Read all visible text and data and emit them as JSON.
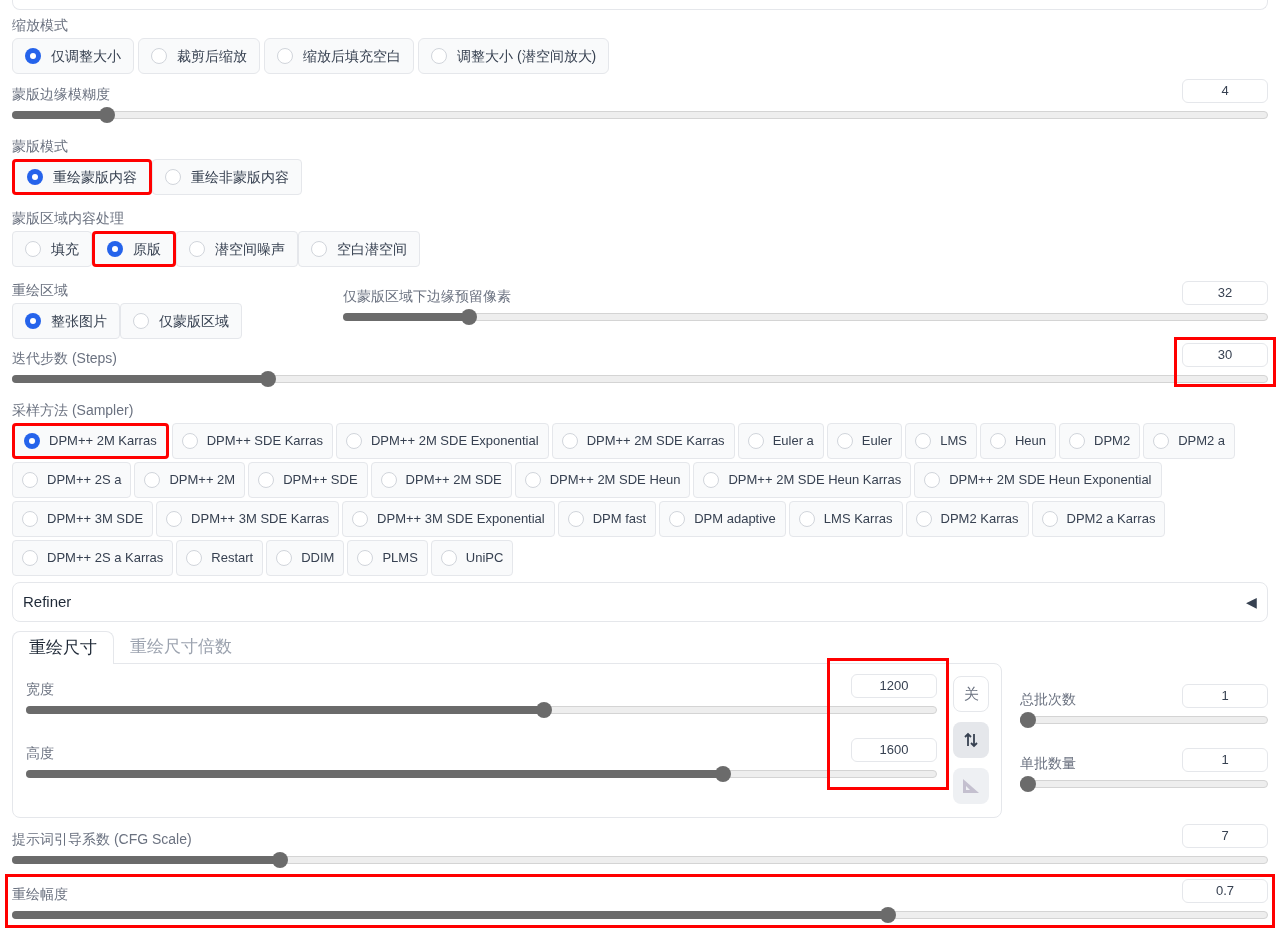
{
  "resize_mode": {
    "label": "缩放模式",
    "options": [
      {
        "label": "仅调整大小",
        "selected": true,
        "highlighted": false
      },
      {
        "label": "裁剪后缩放",
        "selected": false,
        "highlighted": false
      },
      {
        "label": "缩放后填充空白",
        "selected": false,
        "highlighted": false
      },
      {
        "label": "调整大小 (潜空间放大)",
        "selected": false,
        "highlighted": false
      }
    ]
  },
  "mask_blur": {
    "label": "蒙版边缘模糊度",
    "value": "4",
    "level": 0.07
  },
  "mask_mode": {
    "label": "蒙版模式",
    "options": [
      {
        "label": "重绘蒙版内容",
        "selected": true,
        "highlighted": true
      },
      {
        "label": "重绘非蒙版内容",
        "selected": false,
        "highlighted": false
      }
    ]
  },
  "masked_content": {
    "label": "蒙版区域内容处理",
    "options": [
      {
        "label": "填充",
        "selected": false,
        "highlighted": false
      },
      {
        "label": "原版",
        "selected": true,
        "highlighted": true
      },
      {
        "label": "潜空间噪声",
        "selected": false,
        "highlighted": false
      },
      {
        "label": "空白潜空间",
        "selected": false,
        "highlighted": false
      }
    ]
  },
  "inpaint_area": {
    "label": "重绘区域",
    "options": [
      {
        "label": "整张图片",
        "selected": true,
        "highlighted": false
      },
      {
        "label": "仅蒙版区域",
        "selected": false,
        "highlighted": false
      }
    ]
  },
  "padding": {
    "label": "仅蒙版区域下边缘预留像素",
    "value": "32",
    "level": 0.13
  },
  "steps": {
    "label": "迭代步数 (Steps)",
    "value": "30",
    "level": 0.2,
    "highlighted": true
  },
  "sampler": {
    "label": "采样方法 (Sampler)",
    "options": [
      {
        "label": "DPM++ 2M Karras",
        "selected": true,
        "highlighted": true
      },
      {
        "label": "DPM++ SDE Karras",
        "selected": false,
        "highlighted": false
      },
      {
        "label": "DPM++ 2M SDE Exponential",
        "selected": false,
        "highlighted": false
      },
      {
        "label": "DPM++ 2M SDE Karras",
        "selected": false,
        "highlighted": false
      },
      {
        "label": "Euler a",
        "selected": false,
        "highlighted": false
      },
      {
        "label": "Euler",
        "selected": false,
        "highlighted": false
      },
      {
        "label": "LMS",
        "selected": false,
        "highlighted": false
      },
      {
        "label": "Heun",
        "selected": false,
        "highlighted": false
      },
      {
        "label": "DPM2",
        "selected": false,
        "highlighted": false
      },
      {
        "label": "DPM2 a",
        "selected": false,
        "highlighted": false
      },
      {
        "label": "DPM++ 2S a",
        "selected": false,
        "highlighted": false
      },
      {
        "label": "DPM++ 2M",
        "selected": false,
        "highlighted": false
      },
      {
        "label": "DPM++ SDE",
        "selected": false,
        "highlighted": false
      },
      {
        "label": "DPM++ 2M SDE",
        "selected": false,
        "highlighted": false
      },
      {
        "label": "DPM++ 2M SDE Heun",
        "selected": false,
        "highlighted": false
      },
      {
        "label": "DPM++ 2M SDE Heun Karras",
        "selected": false,
        "highlighted": false
      },
      {
        "label": "DPM++ 2M SDE Heun Exponential",
        "selected": false,
        "highlighted": false
      },
      {
        "label": "DPM++ 3M SDE",
        "selected": false,
        "highlighted": false
      },
      {
        "label": "DPM++ 3M SDE Karras",
        "selected": false,
        "highlighted": false
      },
      {
        "label": "DPM++ 3M SDE Exponential",
        "selected": false,
        "highlighted": false
      },
      {
        "label": "DPM fast",
        "selected": false,
        "highlighted": false
      },
      {
        "label": "DPM adaptive",
        "selected": false,
        "highlighted": false
      },
      {
        "label": "LMS Karras",
        "selected": false,
        "highlighted": false
      },
      {
        "label": "DPM2 Karras",
        "selected": false,
        "highlighted": false
      },
      {
        "label": "DPM2 a Karras",
        "selected": false,
        "highlighted": false
      },
      {
        "label": "DPM++ 2S a Karras",
        "selected": false,
        "highlighted": false
      },
      {
        "label": "Restart",
        "selected": false,
        "highlighted": false
      },
      {
        "label": "DDIM",
        "selected": false,
        "highlighted": false
      },
      {
        "label": "PLMS",
        "selected": false,
        "highlighted": false
      },
      {
        "label": "UniPC",
        "selected": false,
        "highlighted": false
      }
    ]
  },
  "refiner": {
    "label": "Refiner",
    "toggle": "◀"
  },
  "size": {
    "tabs": [
      {
        "label": "重绘尺寸",
        "selected": true
      },
      {
        "label": "重绘尺寸倍数",
        "selected": false
      }
    ],
    "width": {
      "label": "宽度",
      "value": "1200",
      "level": 0.57
    },
    "height": {
      "label": "高度",
      "value": "1600",
      "level": 0.77
    },
    "values_highlighted": true,
    "lock_button": "关"
  },
  "batch_count": {
    "label": "总批次数",
    "value": "1",
    "level": 0
  },
  "batch_size": {
    "label": "单批数量",
    "value": "1",
    "level": 0
  },
  "cfg_scale": {
    "label": "提示词引导系数 (CFG Scale)",
    "value": "7",
    "level": 0.21
  },
  "denoising": {
    "label": "重绘幅度",
    "value": "0.7",
    "level": 0.7,
    "highlighted": true
  }
}
